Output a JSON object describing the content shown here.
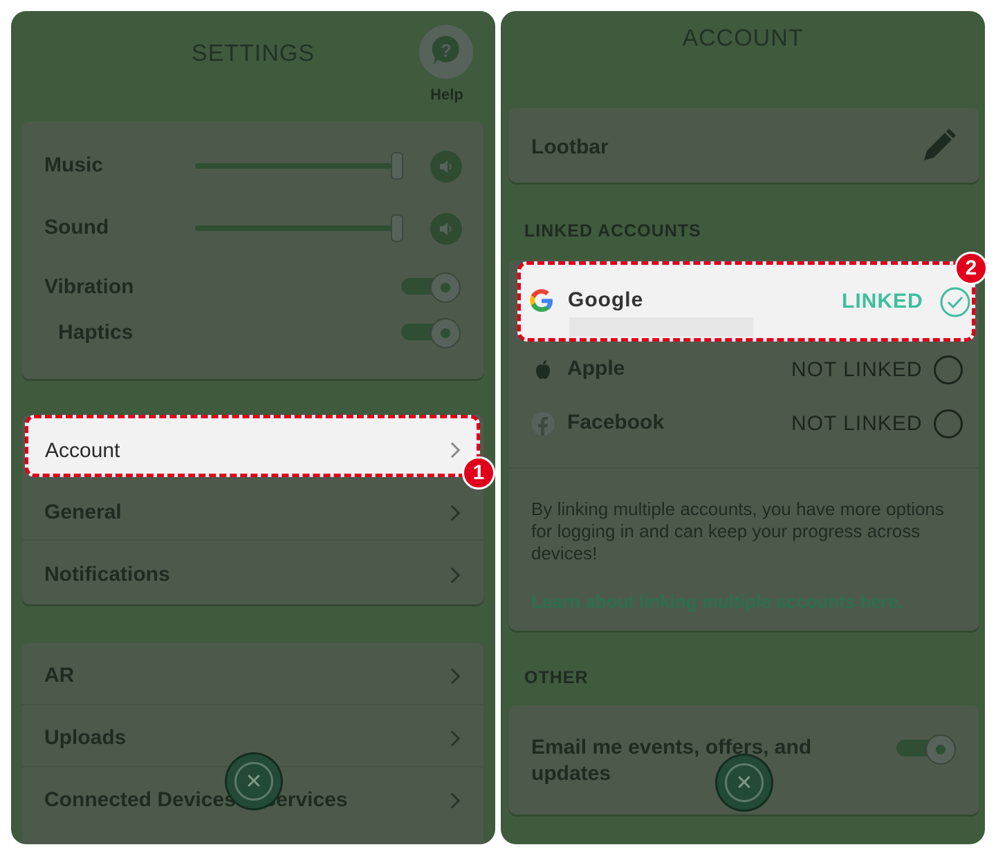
{
  "settings": {
    "title": "SETTINGS",
    "help_label": "Help",
    "audio": {
      "music_label": "Music",
      "music_level": 1.0,
      "sound_label": "Sound",
      "sound_level": 1.0,
      "vibration_label": "Vibration",
      "vibration_on": true,
      "haptics_label": "Haptics",
      "haptics_on": true
    },
    "menu_group1": [
      "Account",
      "General",
      "Notifications"
    ],
    "menu_group2": [
      "AR",
      "Uploads",
      "Connected Devices & Services"
    ],
    "account_badge": "1"
  },
  "account": {
    "title": "ACCOUNT",
    "username": "Lootbar",
    "linked_accounts_heading": "LINKED ACCOUNTS",
    "providers": [
      {
        "name": "Google",
        "status": "LINKED",
        "linked": true
      },
      {
        "name": "Apple",
        "status": "NOT LINKED",
        "linked": false
      },
      {
        "name": "Facebook",
        "status": "NOT LINKED",
        "linked": false
      }
    ],
    "google_badge": "2",
    "info_text": "By linking multiple accounts, you have more options for logging in and can keep your progress across devices!",
    "learn_link": "Learn about linking multiple accounts here.",
    "other_heading": "OTHER",
    "email_pref_label": "Email me events, offers, and updates",
    "email_pref_on": true
  },
  "colors": {
    "highlight": "#e0001b",
    "linked_green": "#3dbf9d",
    "overlay_green": "#3f5a3d"
  }
}
